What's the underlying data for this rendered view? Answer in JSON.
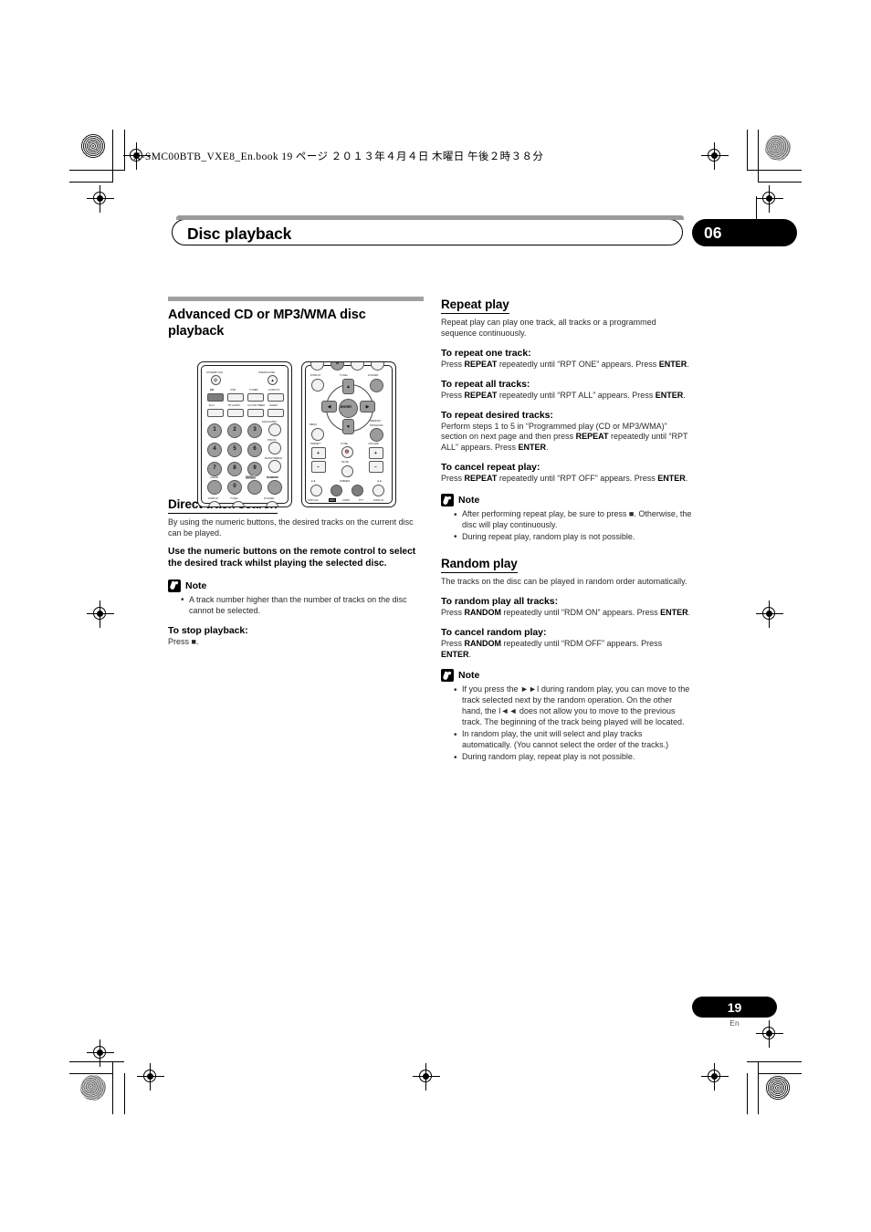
{
  "print_header": {
    "book_line": "X-SMC00BTB_VXE8_En.book   19 ページ   ２０１３年４月４日   木曜日   午後２時３８分"
  },
  "chapter": {
    "title": "Disc playback",
    "number": "06"
  },
  "left_column": {
    "section_title": "Advanced CD or MP3/WMA disc playback",
    "direct_track_search": {
      "heading": "Direct track search",
      "intro": "By using the numeric buttons, the desired tracks on the current disc can be played.",
      "instruction": "Use the numeric buttons on the remote control to select the desired track whilst playing the selected disc.",
      "note_label": "Note",
      "note_bullets": [
        "A track number higher than the number of tracks on the disc cannot be selected."
      ],
      "stop_heading": "To stop playback:",
      "stop_text": "Press ■."
    }
  },
  "right_column": {
    "repeat_play": {
      "heading": "Repeat play",
      "intro": "Repeat play can play one track, all tracks or a programmed sequence continuously.",
      "items": [
        {
          "heading": "To repeat one track:",
          "body_parts": [
            {
              "t": "Press ",
              "b": false
            },
            {
              "t": "REPEAT",
              "b": true
            },
            {
              "t": " repeatedly until “RPT ONE” appears. Press ",
              "b": false
            },
            {
              "t": "ENTER",
              "b": true
            },
            {
              "t": ".",
              "b": false
            }
          ]
        },
        {
          "heading": "To repeat all tracks:",
          "body_parts": [
            {
              "t": "Press ",
              "b": false
            },
            {
              "t": "REPEAT",
              "b": true
            },
            {
              "t": " repeatedly until “RPT ALL” appears. Press ",
              "b": false
            },
            {
              "t": "ENTER",
              "b": true
            },
            {
              "t": ".",
              "b": false
            }
          ]
        },
        {
          "heading": "To repeat desired tracks:",
          "body_parts": [
            {
              "t": "Perform steps 1 to 5 in “Programmed play (CD or MP3/WMA)” section on next page and then press ",
              "b": false
            },
            {
              "t": "REPEAT",
              "b": true
            },
            {
              "t": " repeatedly until “RPT ALL” appears. Press ",
              "b": false
            },
            {
              "t": "ENTER",
              "b": true
            },
            {
              "t": ".",
              "b": false
            }
          ]
        },
        {
          "heading": "To cancel repeat play:",
          "body_parts": [
            {
              "t": "Press ",
              "b": false
            },
            {
              "t": "REPEAT",
              "b": true
            },
            {
              "t": " repeatedly until “RPT OFF” appears. Press ",
              "b": false
            },
            {
              "t": "ENTER",
              "b": true
            },
            {
              "t": ".",
              "b": false
            }
          ]
        }
      ],
      "note_label": "Note",
      "note_bullets": [
        "After performing repeat play, be sure to press ■. Otherwise, the disc will play continuously.",
        "During repeat play, random play is not possible."
      ]
    },
    "random_play": {
      "heading": "Random play",
      "intro": "The tracks on the disc can be played in random order automatically.",
      "items": [
        {
          "heading": "To random play all tracks:",
          "body_parts": [
            {
              "t": "Press ",
              "b": false
            },
            {
              "t": "RANDOM",
              "b": true
            },
            {
              "t": " repeatedly until “RDM ON” appears. Press ",
              "b": false
            },
            {
              "t": "ENTER",
              "b": true
            },
            {
              "t": ".",
              "b": false
            }
          ]
        },
        {
          "heading": "To cancel random play:",
          "body_parts": [
            {
              "t": "Press ",
              "b": false
            },
            {
              "t": "RANDOM",
              "b": true
            },
            {
              "t": " repeatedly until “RDM OFF” appears. Press ",
              "b": false
            },
            {
              "t": "ENTER",
              "b": true
            },
            {
              "t": ".",
              "b": false
            }
          ]
        }
      ],
      "note_label": "Note",
      "note_bullets": [
        "If you press the ►►I during random play, you can move to the track selected next by the random operation. On the other hand, the I◄◄ does not allow you to move to the previous track. The beginning of the track being played will be located.",
        "In random play, the unit will select and play tracks automatically. (You cannot select the order of the tracks.)",
        "During random play, repeat play is not possible."
      ]
    }
  },
  "remote_figure": {
    "left_unit": {
      "labels": [
        "STANDBY/ON",
        "OPEN/CLOSE",
        "CD",
        "USB",
        "TUNER",
        "AUDIO IN",
        "iPod",
        "BT AUDIO",
        "CLOCK/TIMER",
        "SLEEP",
        "EQUALIZER",
        "P.BASS",
        "BASS/TREBLE",
        "CLEAR",
        "REPEAT",
        "RANDOM",
        "DISPLAY",
        "TUNE+",
        "FOLDER"
      ],
      "numeric_keys": [
        "1",
        "2",
        "3",
        "4",
        "5",
        "6",
        "7",
        "8",
        "9",
        "0"
      ]
    },
    "right_unit": {
      "labels": [
        "DISPLAY",
        "TUNE+",
        "FOLDER",
        "ENTER",
        "MENU",
        "MEMORY/PROGRAM",
        "PRESET",
        "TUNE-",
        "VOLUME",
        "MUTE",
        "DIMMER",
        "STBY/AC",
        "RDS",
        "ASPM",
        "PTY",
        "DISPLAY"
      ]
    }
  },
  "footer": {
    "page_number": "19",
    "language": "En"
  }
}
